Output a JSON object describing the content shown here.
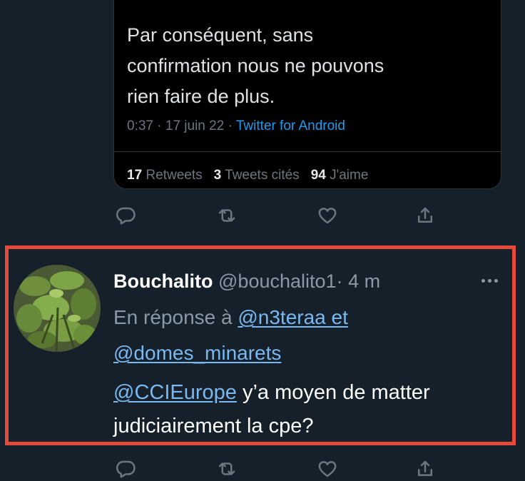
{
  "quoted_tweet": {
    "text_lines": [
      "Par conséquent, sans",
      "confirmation nous ne pouvons",
      "rien faire de plus."
    ],
    "time": "0:37",
    "date": "17 juin 22",
    "separator": "·",
    "source": "Twitter for Android",
    "stats": {
      "retweets_count": "17",
      "retweets_label": "Retweets",
      "quotes_count": "3",
      "quotes_label": "Tweets cités",
      "likes_count": "94",
      "likes_label": "J'aime"
    }
  },
  "reply_tweet": {
    "display_name": "Bouchalito",
    "handle": "@bouchalito1",
    "separator": "·",
    "time": "4 m",
    "reply_prefix": "En réponse à",
    "reply_mention_1": "@n3teraa et",
    "reply_mention_2": "@domes_minarets",
    "body_mention": "@CCIEurope",
    "body_line_1_rest": " y’a moyen de matter",
    "body_line_2": "judiciairement la cpe?"
  },
  "icons": {
    "reply": "reply-icon",
    "retweet": "retweet-icon",
    "like": "heart-icon",
    "share": "share-icon",
    "more": "more-options-icon"
  },
  "colors": {
    "background": "#15202b",
    "highlight_border": "#e5493a",
    "link": "#79b8f0",
    "source_link": "#1d9bf0",
    "muted": "#8b98a5"
  }
}
